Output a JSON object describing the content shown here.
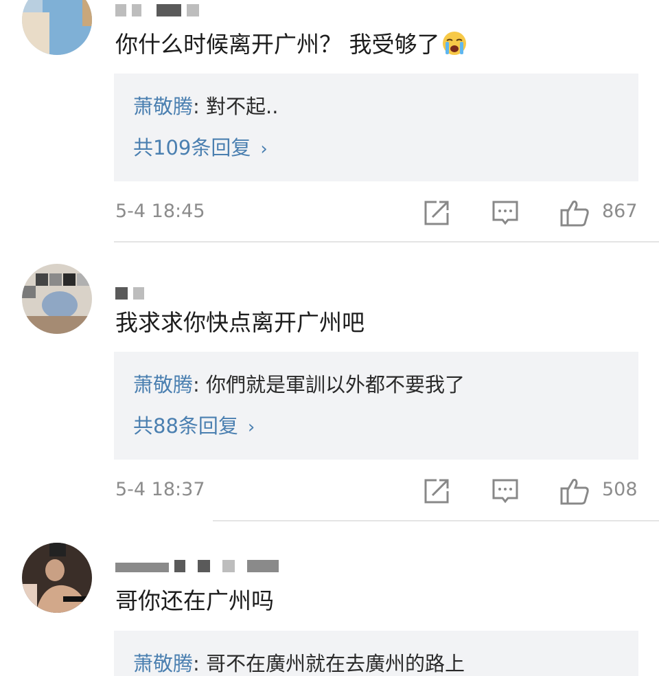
{
  "comments": [
    {
      "text": "你什么时候离开广州？ 我受够了",
      "emoji": "crying-face",
      "reply": {
        "author": "萧敬腾",
        "separator": ":",
        "text": " 對不起..",
        "count_label": "共109条回复",
        "chevron": "›"
      },
      "timestamp": "5-4 18:45",
      "likes": "867"
    },
    {
      "text": "我求求你快点离开广州吧",
      "reply": {
        "author": "萧敬腾",
        "separator": ":",
        "text": " 你們就是軍訓以外都不要我了",
        "count_label": "共88条回复",
        "chevron": "›"
      },
      "timestamp": "5-4 18:37",
      "likes": "508"
    },
    {
      "text": "哥你还在广州吗",
      "reply": {
        "author": "萧敬腾",
        "separator": ":",
        "text": " 哥不在廣州就在去廣州的路上"
      }
    }
  ],
  "icons": {
    "share": "share-icon",
    "comment": "comment-icon",
    "like": "thumbs-up-icon"
  },
  "colors": {
    "reply_author": "#4a7fb0",
    "reply_bg": "#f2f3f5",
    "meta_gray": "#8c8c8c"
  }
}
